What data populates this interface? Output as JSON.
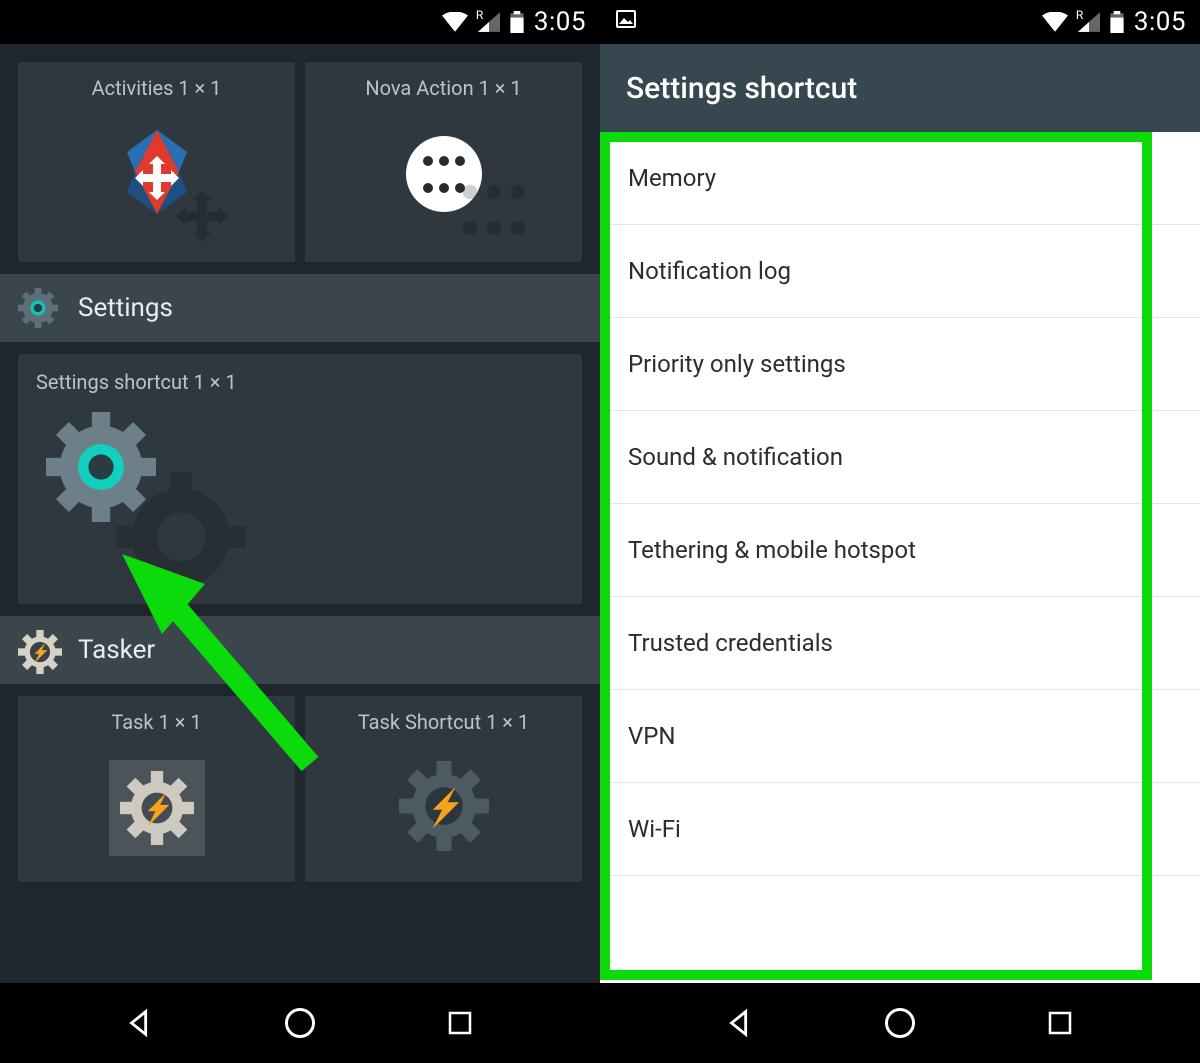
{
  "status": {
    "time": "3:05",
    "roaming": "R"
  },
  "left_screen": {
    "widgets_top": [
      {
        "title": "Activities  1 × 1"
      },
      {
        "title": "Nova Action  1 × 1"
      }
    ],
    "sections": [
      {
        "label": "Settings"
      },
      {
        "label": "Tasker"
      }
    ],
    "settings_widget_title": "Settings shortcut  1 × 1",
    "tasker_widgets": [
      {
        "title": "Task  1 × 1"
      },
      {
        "title": "Task Shortcut  1 × 1"
      }
    ]
  },
  "right_screen": {
    "title": "Settings shortcut",
    "items": [
      "Memory",
      "Notification log",
      "Priority only settings",
      "Sound & notification",
      "Tethering & mobile hotspot",
      "Trusted credentials",
      "VPN",
      "Wi-Fi"
    ]
  }
}
